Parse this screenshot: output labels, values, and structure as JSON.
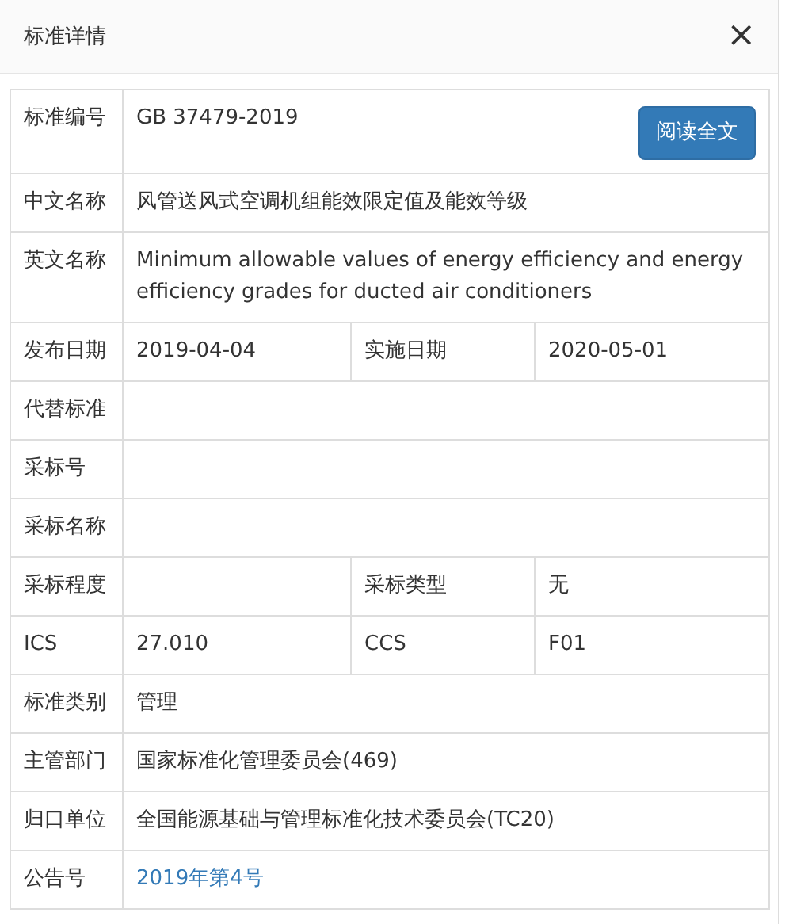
{
  "dialog": {
    "title": "标准详情",
    "close": "×"
  },
  "rows": [
    {
      "fields": [
        {
          "label": "标准编号",
          "value": "GB 37479-2019"
        }
      ],
      "button": "阅读全文"
    },
    {
      "fields": [
        {
          "label": "中文名称",
          "value": "风管送风式空调机组能效限定值及能效等级"
        }
      ]
    },
    {
      "fields": [
        {
          "label": "英文名称",
          "value": "Minimum allowable values of energy efficiency and energy efficiency grades for ducted air conditioners"
        }
      ]
    },
    {
      "fields": [
        {
          "label": "发布日期",
          "value": "2019-04-04"
        },
        {
          "label": "实施日期",
          "value": "2020-05-01"
        }
      ]
    },
    {
      "fields": [
        {
          "label": "代替标准"
        }
      ]
    },
    {
      "fields": [
        {
          "label": "采标号"
        }
      ]
    },
    {
      "fields": [
        {
          "label": "采标名称"
        }
      ]
    },
    {
      "fields": [
        {
          "label": "采标程度"
        },
        {
          "label": "采标类型",
          "value": "无"
        }
      ]
    },
    {
      "fields": [
        {
          "label": "ICS",
          "value": "27.010"
        },
        {
          "label": "CCS",
          "value": "F01"
        }
      ]
    },
    {
      "fields": [
        {
          "label": "标准类别",
          "value": "管理"
        }
      ]
    },
    {
      "fields": [
        {
          "label": "主管部门",
          "value": "国家标准化管理委员会(469)"
        }
      ]
    },
    {
      "fields": [
        {
          "label": "归口单位",
          "value": "全国能源基础与管理标准化技术委员会(TC20)"
        }
      ]
    },
    {
      "fields": [
        {
          "label": "公告号",
          "value": "2019年第4号",
          "kind": "link"
        }
      ]
    }
  ]
}
